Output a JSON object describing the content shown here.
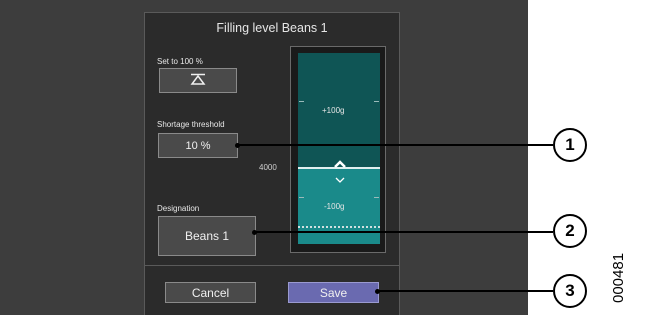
{
  "dialog": {
    "title": "Filling level Beans 1",
    "set_to_100_label": "Set to 100 %",
    "shortage_threshold_label": "Shortage threshold",
    "shortage_threshold_value": "10 %",
    "designation_label": "Designation",
    "designation_value": "Beans 1",
    "cancel_label": "Cancel",
    "save_label": "Save"
  },
  "gauge": {
    "upper_label": "+100g",
    "lower_label": "-100g",
    "current_value": "4000",
    "top_color": "#0f5555",
    "bottom_color": "#1a8a8a"
  },
  "callouts": [
    "1",
    "2",
    "3"
  ],
  "figure_id": "000481",
  "colors": {
    "save_button": "#6a6ab0",
    "background": "#3d3d3d",
    "panel": "#2b2b2b"
  }
}
